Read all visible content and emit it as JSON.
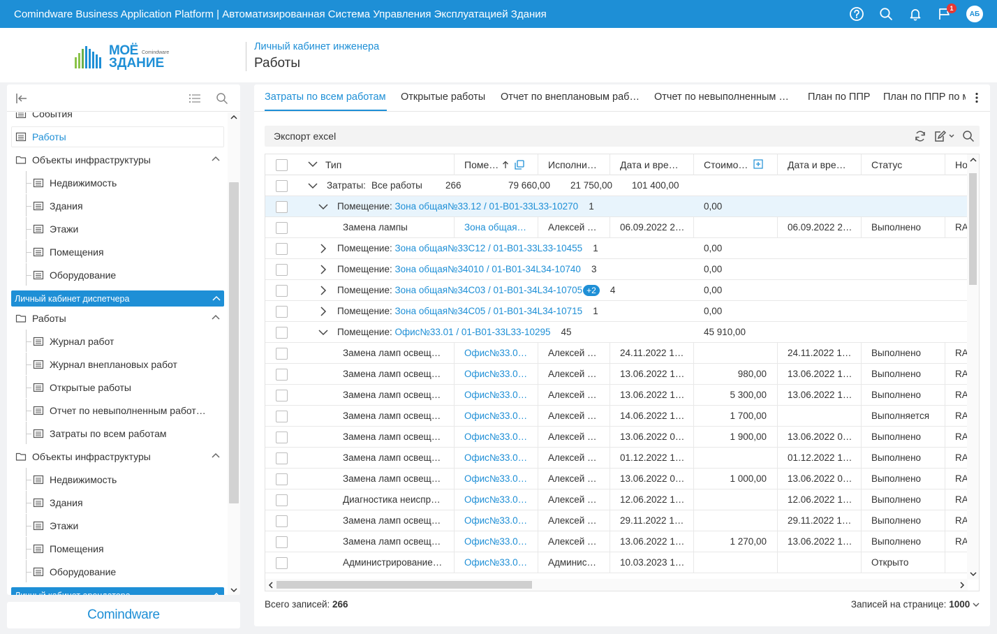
{
  "topbar": {
    "title": "Comindware Business Application Platform  |  Автоматизированная Система Управления Эксплуатацией Здания",
    "notification_count": "1",
    "avatar": "АБ",
    "icons": [
      "help-icon",
      "search-icon",
      "bell-icon",
      "flag-icon"
    ]
  },
  "header": {
    "logo_line1": "МОЁ",
    "logo_brand": "Comindware",
    "logo_line2": "ЗДАНИЕ",
    "breadcrumb": "Личный кабинет инженера",
    "page_title": "Работы"
  },
  "sidebar": {
    "items": [
      {
        "label": "События",
        "icon": "list-icon",
        "indent": 0
      },
      {
        "label": "Работы",
        "icon": "list-icon",
        "indent": 0,
        "selected": true
      },
      {
        "label": "Объекты инфраструктуры",
        "icon": "folder-icon",
        "indent": 0,
        "expanded": true
      },
      {
        "label": "Недвижимость",
        "icon": "list-icon",
        "indent": 1
      },
      {
        "label": "Здания",
        "icon": "list-icon",
        "indent": 1
      },
      {
        "label": "Этажи",
        "icon": "list-icon",
        "indent": 1
      },
      {
        "label": "Помещения",
        "icon": "list-icon",
        "indent": 1
      },
      {
        "label": "Оборудование",
        "icon": "list-icon",
        "indent": 1
      },
      {
        "section": "Личный кабинет диспетчера"
      },
      {
        "label": "Работы",
        "icon": "folder-icon",
        "indent": 0,
        "expanded": true
      },
      {
        "label": "Журнал работ",
        "icon": "list-icon",
        "indent": 1
      },
      {
        "label": "Журнал внеплановых работ",
        "icon": "list-icon",
        "indent": 1
      },
      {
        "label": "Открытые работы",
        "icon": "list-icon",
        "indent": 1
      },
      {
        "label": "Отчет по невыполненным работ…",
        "icon": "list-icon",
        "indent": 1
      },
      {
        "label": "Затраты по всем работам",
        "icon": "list-icon",
        "indent": 1
      },
      {
        "label": "Объекты инфраструктуры",
        "icon": "folder-icon",
        "indent": 0,
        "expanded": true
      },
      {
        "label": "Недвижимость",
        "icon": "list-icon",
        "indent": 1
      },
      {
        "label": "Здания",
        "icon": "list-icon",
        "indent": 1
      },
      {
        "label": "Этажи",
        "icon": "list-icon",
        "indent": 1
      },
      {
        "label": "Помещения",
        "icon": "list-icon",
        "indent": 1
      },
      {
        "label": "Оборудование",
        "icon": "list-icon",
        "indent": 1
      },
      {
        "section": "Личный кабинет арендатора"
      }
    ]
  },
  "brand_footer": "Comindware",
  "tabs": [
    "Затраты по всем работам",
    "Открытые работы",
    "Отчет по внеплановым раб…",
    "Отчет по невыполненным …",
    "План по ППР",
    "План по ППР по м"
  ],
  "toolbar": {
    "export_label": "Экспорт excel"
  },
  "grid": {
    "columns": [
      "Тип",
      "Поме…",
      "Исполни…",
      "Дата и вре…",
      "Стоимо…",
      "Дата и вре…",
      "Статус",
      "Но"
    ],
    "summary": {
      "prefix": "Затраты:",
      "label": "Все работы",
      "count": "266",
      "v1": "79 660,00",
      "v2": "21 750,00",
      "v3": "101 400,00"
    },
    "rows": [
      {
        "kind": "group",
        "open": true,
        "prefix": "Помещение:",
        "link": "Зона общая№33.12 / 01-B01-33L33-10270",
        "count": "1",
        "cost": "0,00",
        "hl": true
      },
      {
        "kind": "data",
        "type": "Замена лампы",
        "room": "Зона общая…",
        "exec": "Алексей …",
        "date1": "06.09.2022 2…",
        "cost": "",
        "date2": "06.09.2022 2…",
        "status": "Выполнено",
        "no": "RA"
      },
      {
        "kind": "group",
        "open": false,
        "prefix": "Помещение:",
        "link": "Зона общая№33С12 / 01-B01-33L33-10455",
        "count": "1",
        "cost": "0,00"
      },
      {
        "kind": "group",
        "open": false,
        "prefix": "Помещение:",
        "link": "Зона общая№34010 / 01-B01-34L34-10740",
        "count": "3",
        "cost": "0,00"
      },
      {
        "kind": "group",
        "open": false,
        "prefix": "Помещение:",
        "link": "Зона общая№34С03 / 01-B01-34L34-10705",
        "extra": "+2",
        "count": "4",
        "cost": "0,00"
      },
      {
        "kind": "group",
        "open": false,
        "prefix": "Помещение:",
        "link": "Зона общая№34С05 / 01-B01-34L34-10715",
        "count": "1",
        "cost": "0,00"
      },
      {
        "kind": "group",
        "open": true,
        "prefix": "Помещение:",
        "link": "Офис№33.01 / 01-B01-33L33-10295",
        "count": "45",
        "cost": "45 910,00"
      },
      {
        "kind": "data",
        "type": "Замена ламп освещ…",
        "room": "Офис№33.0…",
        "exec": "Алексей …",
        "date1": "24.11.2022 1…",
        "cost": "",
        "date2": "24.11.2022 1…",
        "status": "Выполнено",
        "no": "RA"
      },
      {
        "kind": "data",
        "type": "Замена ламп освещ…",
        "room": "Офис№33.0…",
        "exec": "Алексей …",
        "date1": "13.06.2022 1…",
        "cost": "980,00",
        "date2": "13.06.2022 1…",
        "status": "Выполнено",
        "no": "RA"
      },
      {
        "kind": "data",
        "type": "Замена ламп освещ…",
        "room": "Офис№33.0…",
        "exec": "Алексей …",
        "date1": "13.06.2022 1…",
        "cost": "5 300,00",
        "date2": "13.06.2022 1…",
        "status": "Выполнено",
        "no": "RA"
      },
      {
        "kind": "data",
        "type": "Замена ламп освещ…",
        "room": "Офис№33.0…",
        "exec": "Алексей …",
        "date1": "14.06.2022 1…",
        "cost": "1 700,00",
        "date2": "",
        "status": "Выполняется",
        "no": "RA"
      },
      {
        "kind": "data",
        "type": "Замена ламп освещ…",
        "room": "Офис№33.0…",
        "exec": "Алексей …",
        "date1": "13.06.2022 0…",
        "cost": "1 900,00",
        "date2": "13.06.2022 0…",
        "status": "Выполнено",
        "no": "RA"
      },
      {
        "kind": "data",
        "type": "Замена ламп освещ…",
        "room": "Офис№33.0…",
        "exec": "Алексей …",
        "date1": "01.12.2022 1…",
        "cost": "",
        "date2": "01.12.2022 1…",
        "status": "Выполнено",
        "no": "RA"
      },
      {
        "kind": "data",
        "type": "Замена ламп освещ…",
        "room": "Офис№33.0…",
        "exec": "Алексей …",
        "date1": "13.06.2022 0…",
        "cost": "1 000,00",
        "date2": "13.06.2022 0…",
        "status": "Выполнено",
        "no": "RA"
      },
      {
        "kind": "data",
        "type": "Диагностика неиспр…",
        "room": "Офис№33.0…",
        "exec": "Алексей …",
        "date1": "12.06.2022 1…",
        "cost": "",
        "date2": "12.06.2022 1…",
        "status": "Выполнено",
        "no": "RA"
      },
      {
        "kind": "data",
        "type": "Замена ламп освещ…",
        "room": "Офис№33.0…",
        "exec": "Алексей …",
        "date1": "29.11.2022 1…",
        "cost": "",
        "date2": "29.11.2022 1…",
        "status": "Выполнено",
        "no": "RA"
      },
      {
        "kind": "data",
        "type": "Замена ламп освещ…",
        "room": "Офис№33.0…",
        "exec": "Алексей …",
        "date1": "13.06.2022 1…",
        "cost": "1 270,00",
        "date2": "13.06.2022 1…",
        "status": "Выполнено",
        "no": "RA"
      },
      {
        "kind": "data",
        "type": "Администрирование…",
        "room": "Офис№33.0…",
        "exec": "Админис…",
        "date1": "10.03.2023 1…",
        "cost": "",
        "date2": "",
        "status": "Открыто",
        "no": ""
      }
    ]
  },
  "footer": {
    "total_label": "Всего записей:",
    "total_value": "266",
    "per_page_label": "Записей на странице:",
    "per_page_value": "1000"
  }
}
